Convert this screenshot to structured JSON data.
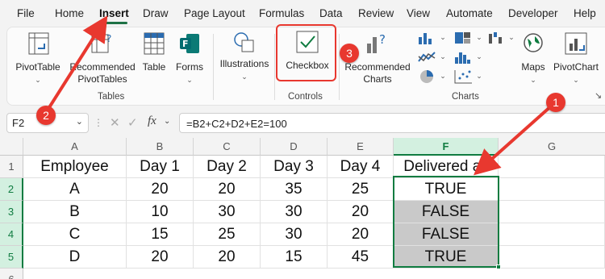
{
  "tabs": [
    "File",
    "Home",
    "Insert",
    "Draw",
    "Page Layout",
    "Formulas",
    "Data",
    "Review",
    "View",
    "Automate",
    "Developer",
    "Help"
  ],
  "active_tab": "Insert",
  "ribbon": {
    "pivottable": "PivotTable",
    "recommended_pivottables": "Recommended PivotTables",
    "table": "Table",
    "forms": "Forms",
    "illustrations": "Illustrations",
    "checkbox": "Checkbox",
    "recommended_charts": "Recommended Charts",
    "maps": "Maps",
    "pivotchart": "PivotChart",
    "groups": {
      "tables": "Tables",
      "controls": "Controls",
      "charts": "Charts"
    }
  },
  "formula_bar": {
    "name_box": "F2",
    "fx": "fx",
    "formula": "=B2+C2+D2+E2=100"
  },
  "sheet": {
    "columns": [
      "A",
      "B",
      "C",
      "D",
      "E",
      "F",
      "G"
    ],
    "rows": [
      "1",
      "2",
      "3",
      "4",
      "5",
      "6"
    ],
    "cells": [
      [
        "Employee",
        "Day 1",
        "Day 2",
        "Day 3",
        "Day 4",
        "Delivered all"
      ],
      [
        "A",
        "20",
        "20",
        "35",
        "25",
        "TRUE"
      ],
      [
        "B",
        "10",
        "30",
        "30",
        "20",
        "FALSE"
      ],
      [
        "C",
        "15",
        "25",
        "30",
        "20",
        "FALSE"
      ],
      [
        "D",
        "20",
        "20",
        "15",
        "45",
        "TRUE"
      ]
    ],
    "selected_cell": "F2"
  },
  "annotations": [
    "1",
    "2",
    "3"
  ],
  "colors": {
    "accent": "#107c41",
    "annotation": "#e8382f",
    "shaded_cell": "#c9c9c9"
  }
}
